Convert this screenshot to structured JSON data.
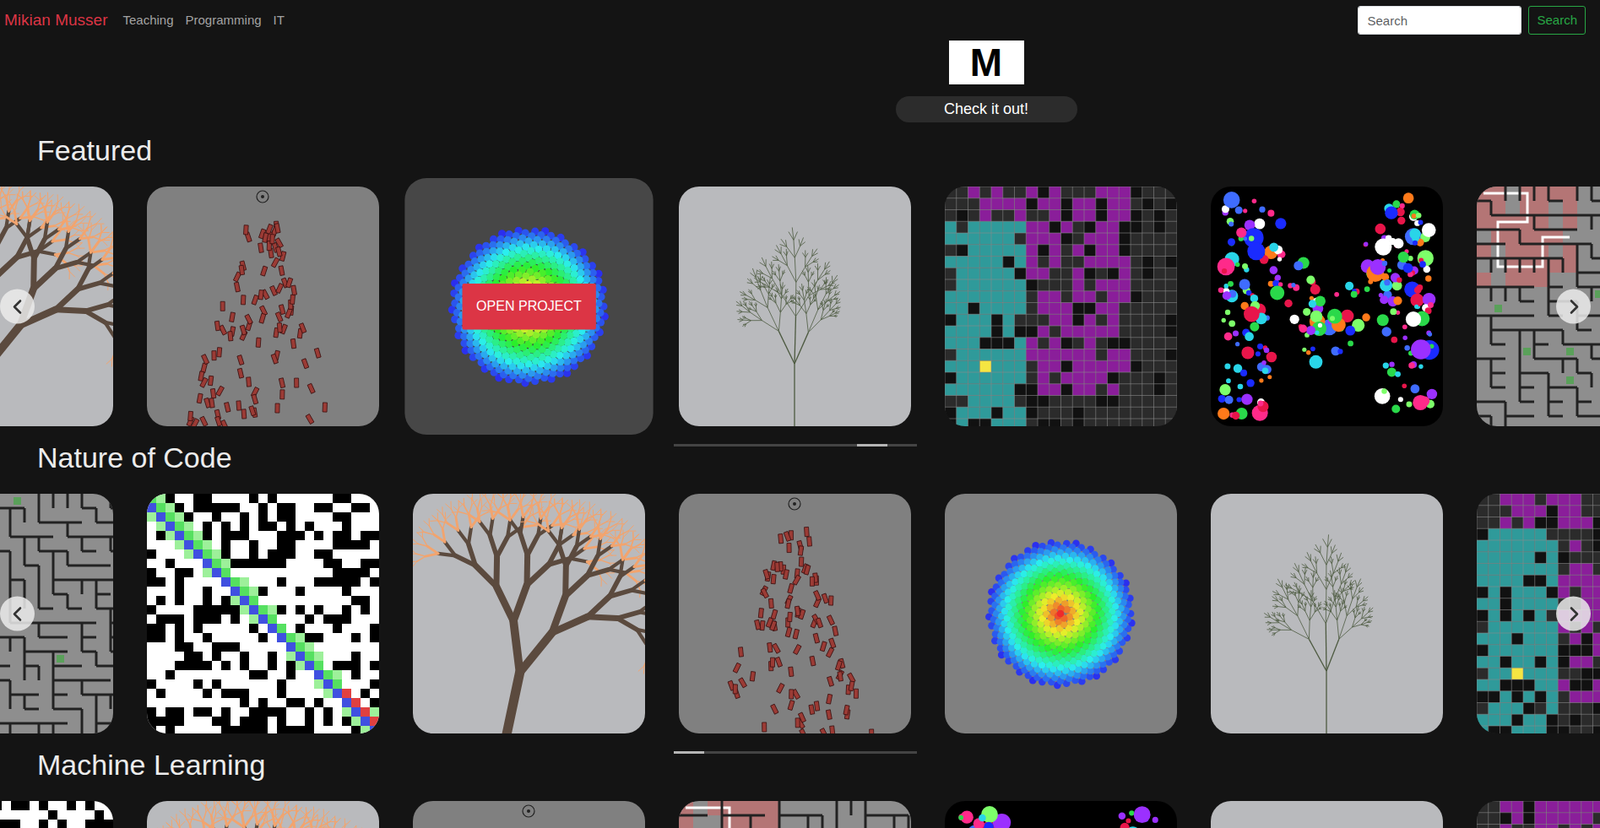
{
  "nav": {
    "brand": "Mikian Musser",
    "links": [
      {
        "label": "Teaching"
      },
      {
        "label": "Programming"
      },
      {
        "label": "IT"
      }
    ],
    "search": {
      "placeholder": "Search",
      "button": "Search"
    }
  },
  "hero": {
    "logo": "M",
    "button": "Check it out!"
  },
  "hover_action": "OPEN PROJECT",
  "rows": [
    {
      "title": "Featured",
      "scroll": {
        "level": 0.86
      },
      "tiles": [
        {
          "kind": "fractal-tree",
          "hovered": false
        },
        {
          "kind": "boids",
          "hovered": false
        },
        {
          "kind": "phyllotaxis",
          "hovered": true
        },
        {
          "kind": "l-system",
          "hovered": false
        },
        {
          "kind": "maze-search",
          "hovered": false
        },
        {
          "kind": "circle-packing",
          "hovered": false
        },
        {
          "kind": "maze",
          "hovered": false
        }
      ]
    },
    {
      "title": "Nature of Code",
      "scroll": {
        "level": 0.0
      },
      "tiles": [
        {
          "kind": "maze",
          "hovered": false
        },
        {
          "kind": "pathfinding",
          "hovered": false
        },
        {
          "kind": "fractal-tree",
          "hovered": false
        },
        {
          "kind": "boids",
          "hovered": false
        },
        {
          "kind": "phyllotaxis",
          "hovered": false
        },
        {
          "kind": "l-system",
          "hovered": false
        },
        {
          "kind": "maze-search",
          "hovered": false
        }
      ]
    },
    {
      "title": "Machine Learning",
      "tiles": [
        {
          "kind": "pathfinding",
          "hovered": false
        },
        {
          "kind": "fractal-tree",
          "hovered": false
        },
        {
          "kind": "boids",
          "hovered": false
        },
        {
          "kind": "maze",
          "hovered": false
        },
        {
          "kind": "circle-packing",
          "hovered": false
        },
        {
          "kind": "l-system",
          "hovered": false
        },
        {
          "kind": "maze-search",
          "hovered": false
        }
      ]
    }
  ]
}
